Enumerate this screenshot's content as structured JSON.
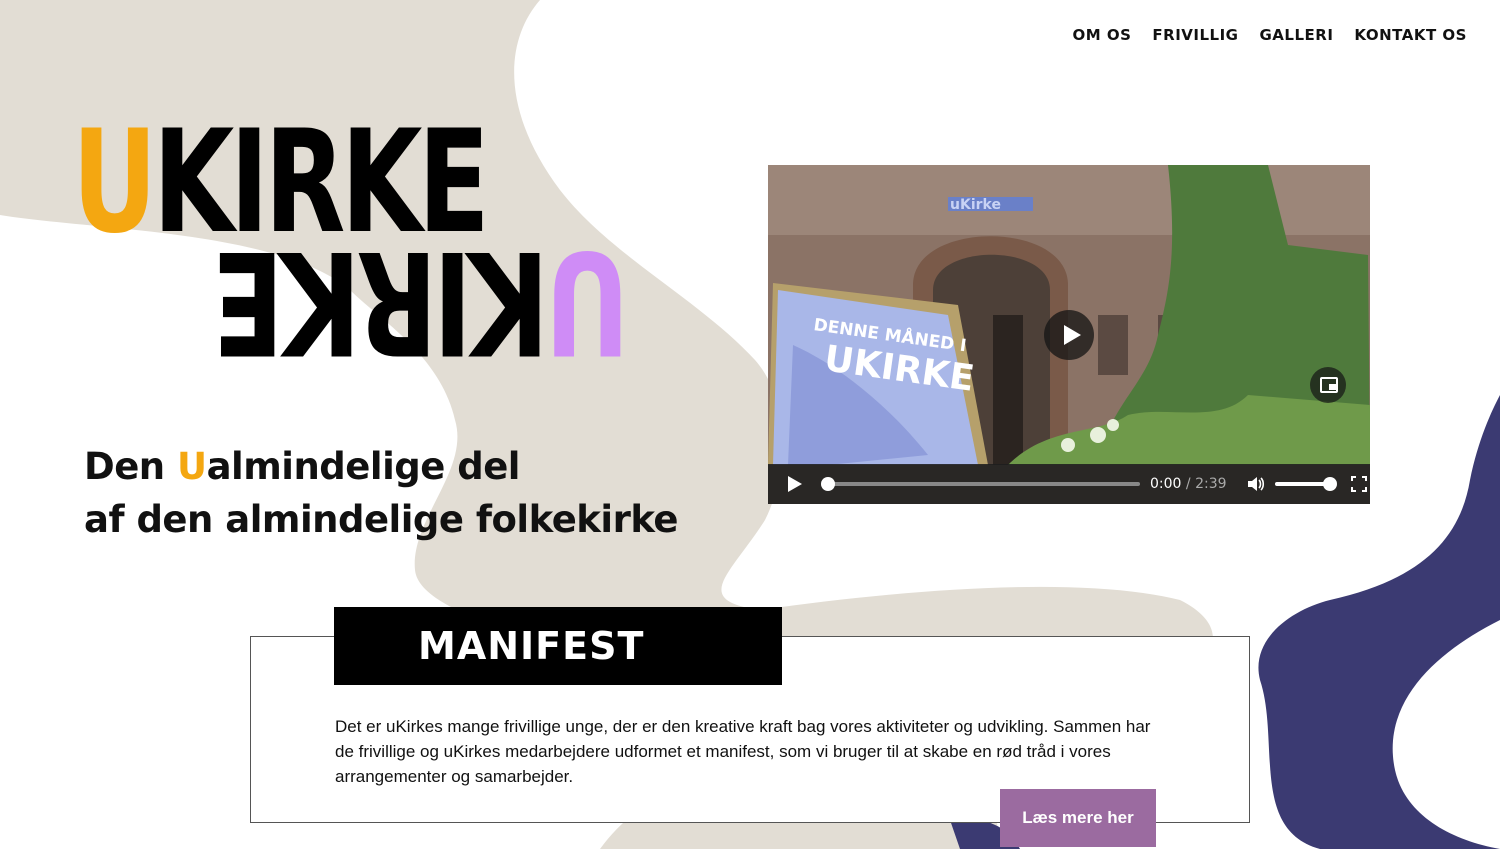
{
  "nav": {
    "items": [
      {
        "label": "OM OS"
      },
      {
        "label": "FRIVILLIG"
      },
      {
        "label": "GALLERI"
      },
      {
        "label": "KONTAKT OS"
      }
    ]
  },
  "logo": {
    "top_u": "U",
    "top_rest": "KIRKE",
    "bottom_u": "U",
    "bottom_rest": "KIRKE",
    "colors": {
      "u_top": "#f4a711",
      "u_bottom": "#cf8cf6",
      "letters": "#000000"
    }
  },
  "tagline": {
    "line1_pre": "Den ",
    "line1_hl": "U",
    "line1_post": "almindelige del",
    "line2": "af den almindelige folkekirke"
  },
  "video": {
    "poster_text_1": "DENNE MÅNED I",
    "poster_text_2": "UKIRKE",
    "sign_text": "uKirke",
    "current_time": "0:00",
    "duration": "/ 2:39",
    "progress": 0,
    "volume": 1.0
  },
  "manifest": {
    "title": "MANIFEST",
    "body": "Det er uKirkes mange frivillige unge, der er den kreative kraft bag vores aktiviteter og udvikling. Sammen har de frivillige og uKirkes medarbejdere udformet et manifest, som vi bruger til at skabe en rød tråd i vores arrangementer og samarbejder.",
    "button_label": "Læs mere her"
  },
  "colors": {
    "beige_blob": "#e2ddd4",
    "navy_blob": "#3b3a72",
    "button": "#9b6ba0",
    "accent_yellow": "#f4a711",
    "accent_purple": "#cf8cf6"
  }
}
